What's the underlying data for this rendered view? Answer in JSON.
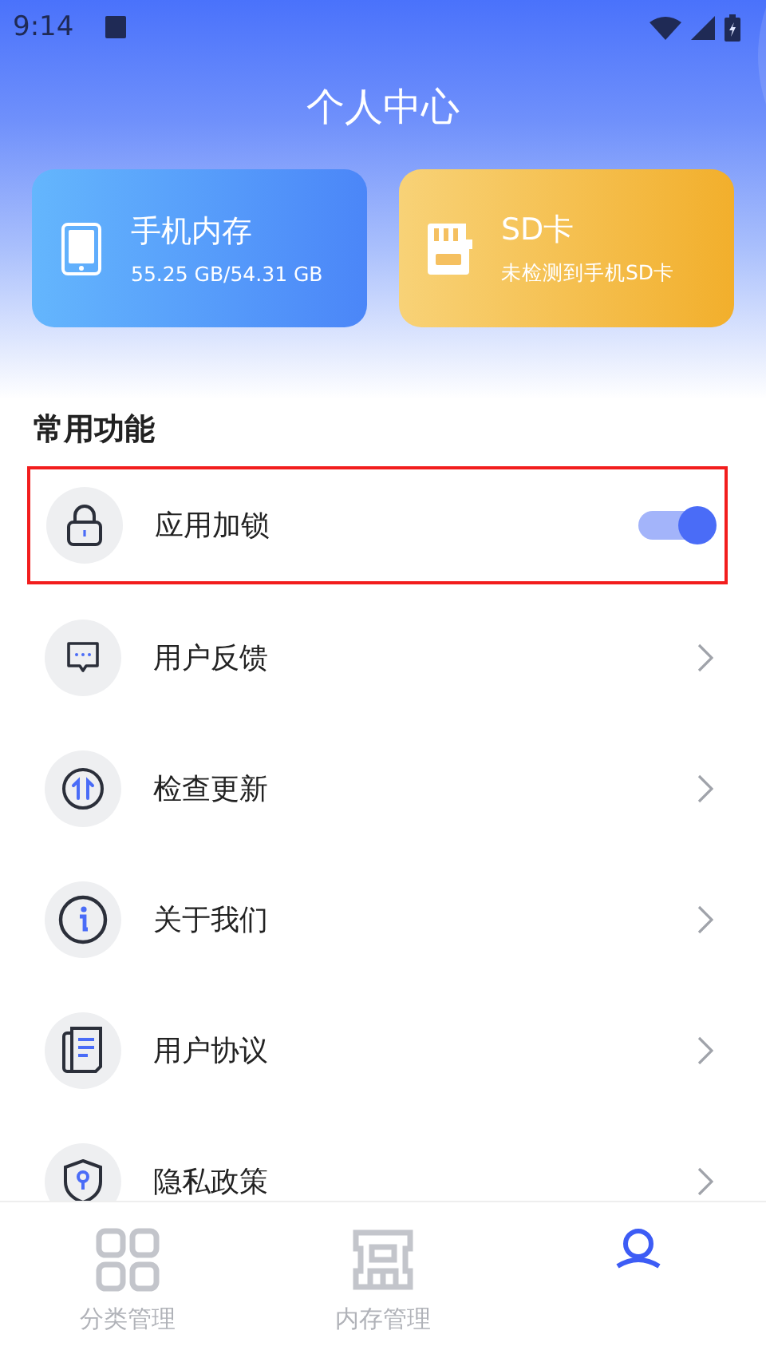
{
  "status_bar": {
    "time": "9:14"
  },
  "header": {
    "title": "个人中心"
  },
  "cards": [
    {
      "kind": "phone",
      "title": "手机内存",
      "subtitle": "55.25 GB/54.31 GB"
    },
    {
      "kind": "sd",
      "title": "SD卡",
      "subtitle": "未检测到手机SD卡"
    }
  ],
  "section": {
    "title": "常用功能"
  },
  "items": [
    {
      "kind": "toggle",
      "label": "应用加锁",
      "on": true,
      "highlighted": true
    },
    {
      "kind": "link",
      "label": "用户反馈",
      "highlighted": false
    },
    {
      "kind": "link",
      "label": "检查更新",
      "highlighted": false
    },
    {
      "kind": "link",
      "label": "关于我们",
      "highlighted": false
    },
    {
      "kind": "link",
      "label": "用户协议",
      "highlighted": false
    },
    {
      "kind": "link",
      "label": "隐私政策",
      "highlighted": false
    }
  ],
  "tabs": [
    {
      "label": "分类管理",
      "selected": false
    },
    {
      "label": "内存管理",
      "selected": false
    },
    {
      "selected": true
    }
  ]
}
